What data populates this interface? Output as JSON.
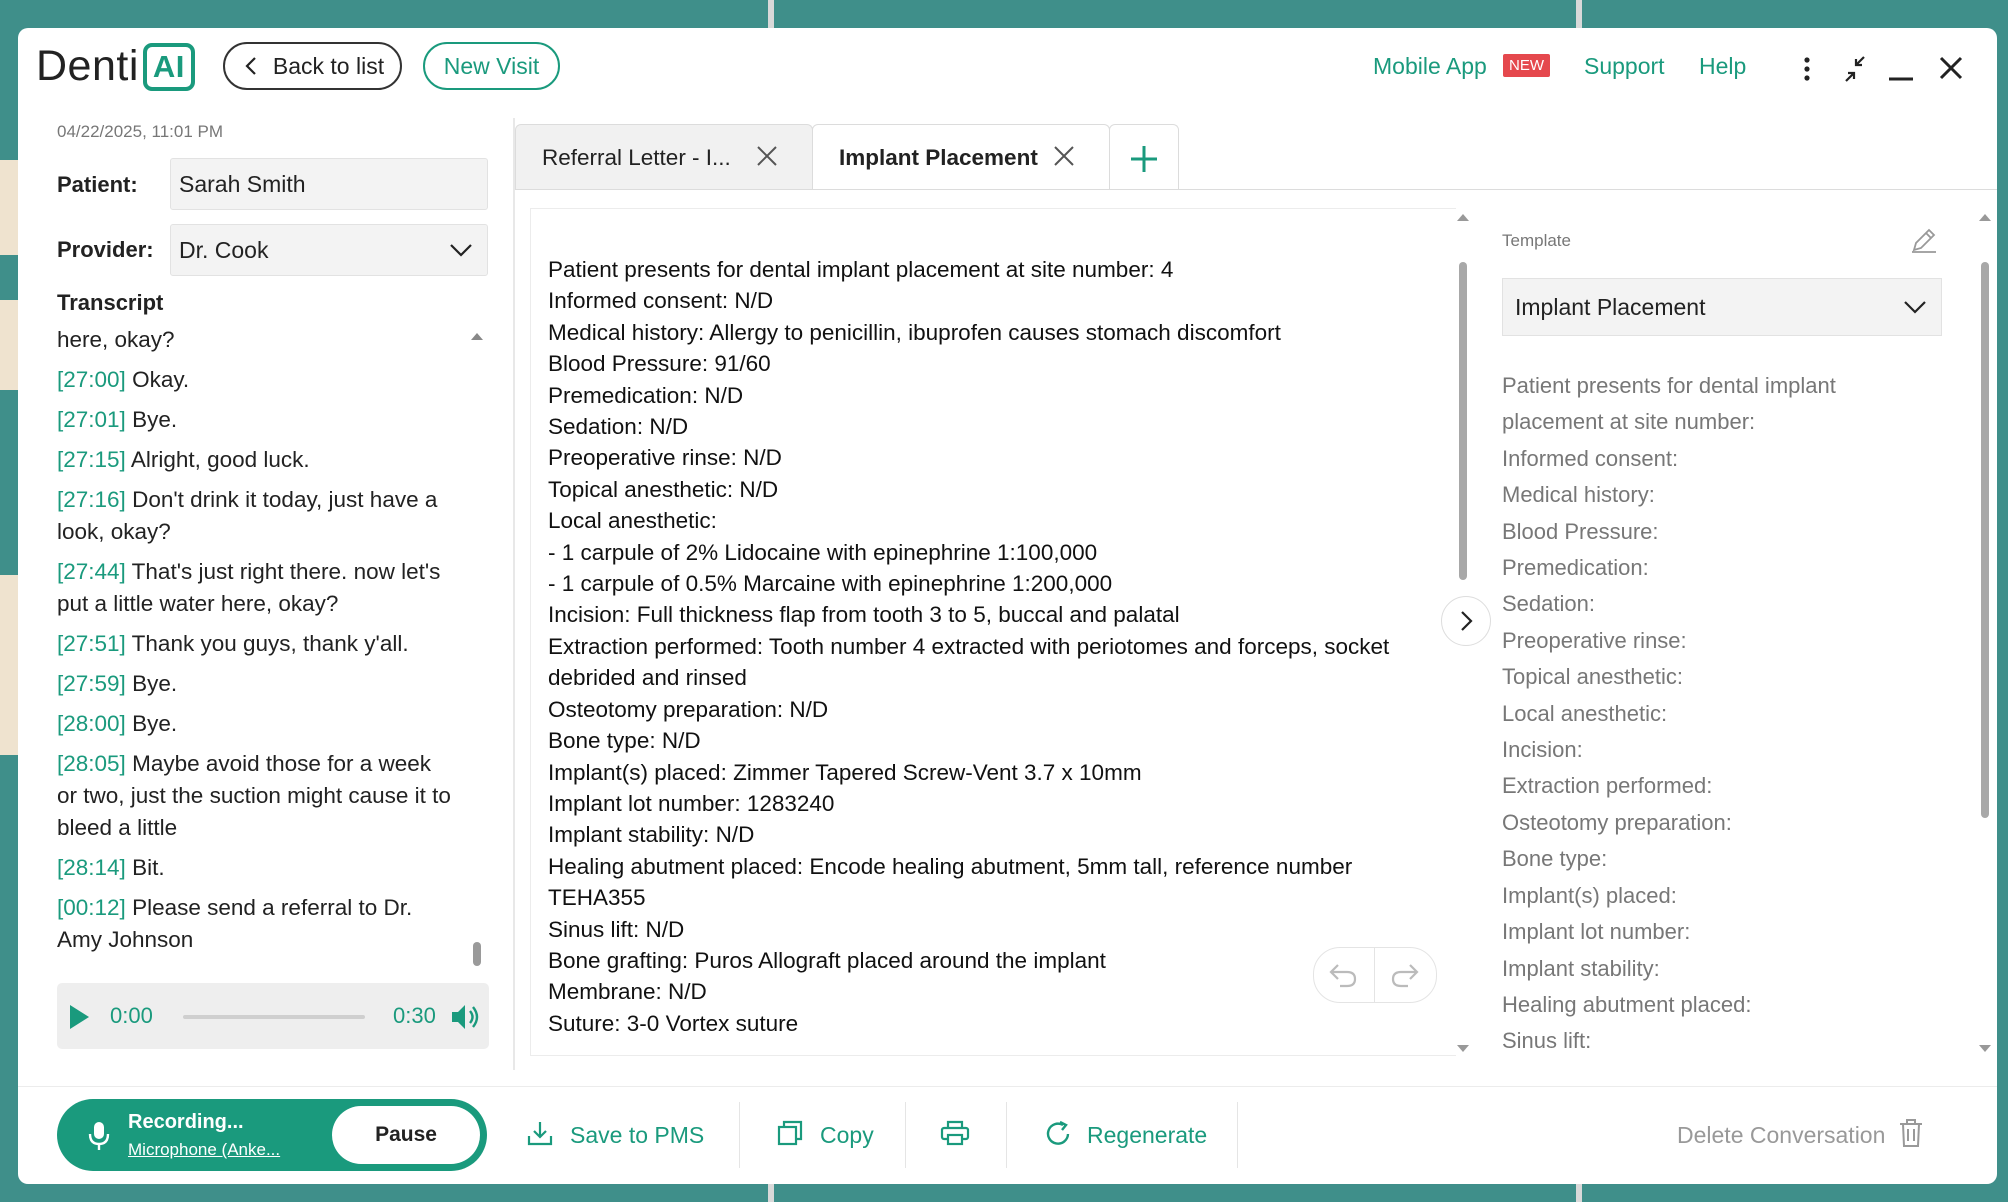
{
  "app": {
    "logo_text": "Denti",
    "logo_badge": "AI",
    "back_label": "Back to list",
    "new_visit_label": "New Visit",
    "mobile_app_label": "Mobile App",
    "new_badge": "NEW",
    "support_label": "Support",
    "help_label": "Help",
    "icons": [
      "more-vertical-icon",
      "collapse-icon",
      "minimize-icon",
      "close-icon"
    ]
  },
  "visit": {
    "datetime": "04/22/2025, 11:01 PM",
    "patient_label": "Patient:",
    "patient_value": "Sarah Smith",
    "provider_label": "Provider:",
    "provider_value": "Dr. Cook"
  },
  "transcript": {
    "title": "Transcript",
    "lines": [
      {
        "ts": "",
        "text": "here, okay?"
      },
      {
        "ts": "[27:00]",
        "text": "Okay."
      },
      {
        "ts": "[27:01]",
        "text": "Bye."
      },
      {
        "ts": "[27:15]",
        "text": "Alright, good luck."
      },
      {
        "ts": "[27:16]",
        "text": "Don't drink it today, just have a look, okay?"
      },
      {
        "ts": "[27:44]",
        "text": "That's just right there. now let's put a little water here, okay?"
      },
      {
        "ts": "[27:51]",
        "text": "Thank you guys, thank y'all."
      },
      {
        "ts": "[27:59]",
        "text": "Bye."
      },
      {
        "ts": "[28:00]",
        "text": "Bye."
      },
      {
        "ts": "[28:05]",
        "text": "Maybe avoid those for a week or two, just the suction might cause it to bleed a little"
      },
      {
        "ts": "[28:14]",
        "text": "Bit."
      },
      {
        "ts": "[00:12]",
        "text": "Please send a referral to Dr. Amy Johnson"
      }
    ]
  },
  "player": {
    "current": "0:00",
    "duration": "0:30",
    "progress": 0
  },
  "tabs": [
    {
      "label": "Referral Letter - I...",
      "active": false
    },
    {
      "label": "Implant Placement",
      "active": true
    }
  ],
  "note": {
    "lines": [
      "Patient presents for dental implant placement at site number: 4",
      "Informed consent: N/D",
      "Medical history: Allergy to penicillin, ibuprofen causes stomach discomfort",
      "Blood Pressure: 91/60",
      "Premedication: N/D",
      "Sedation: N/D",
      "Preoperative rinse: N/D",
      "Topical anesthetic: N/D",
      "Local anesthetic:",
      "- 1 carpule of 2% Lidocaine with epinephrine 1:100,000",
      "- 1 carpule of 0.5% Marcaine with epinephrine 1:200,000",
      "Incision: Full thickness flap from tooth 3 to 5, buccal and palatal",
      "Extraction performed: Tooth number 4 extracted with periotomes and forceps, socket debrided and rinsed",
      "Osteotomy preparation: N/D",
      "Bone type: N/D",
      "Implant(s) placed: Zimmer Tapered Screw-Vent 3.7 x 10mm",
      "Implant lot number: 1283240",
      "Implant stability: N/D",
      "Healing abutment placed: Encode healing abutment, 5mm tall, reference number TEHA355",
      "Sinus lift: N/D",
      "Bone grafting: Puros Allograft placed around the implant",
      "Membrane: N/D",
      "Suture: 3-0 Vortex suture"
    ]
  },
  "template": {
    "header": "Template",
    "selected": "Implant Placement",
    "fields": [
      "Patient presents for dental implant placement at site number:",
      "Informed consent:",
      "Medical history:",
      "Blood Pressure:",
      "Premedication:",
      "Sedation:",
      "Preoperative rinse:",
      "Topical anesthetic:",
      "Local anesthetic:",
      "Incision:",
      "Extraction performed:",
      "Osteotomy preparation:",
      "Bone type:",
      "Implant(s) placed:",
      "Implant lot number:",
      "Implant stability:",
      "Healing abutment placed:",
      "Sinus lift:"
    ]
  },
  "footer": {
    "recording_label": "Recording...",
    "microphone_label": "Microphone (Anke...",
    "pause_label": "Pause",
    "save_label": "Save to PMS",
    "copy_label": "Copy",
    "regenerate_label": "Regenerate",
    "delete_label": "Delete Conversation"
  },
  "colors": {
    "accent": "#1a9a7d",
    "badge_red": "#e5484d",
    "desktop": "#3f8f8a"
  }
}
